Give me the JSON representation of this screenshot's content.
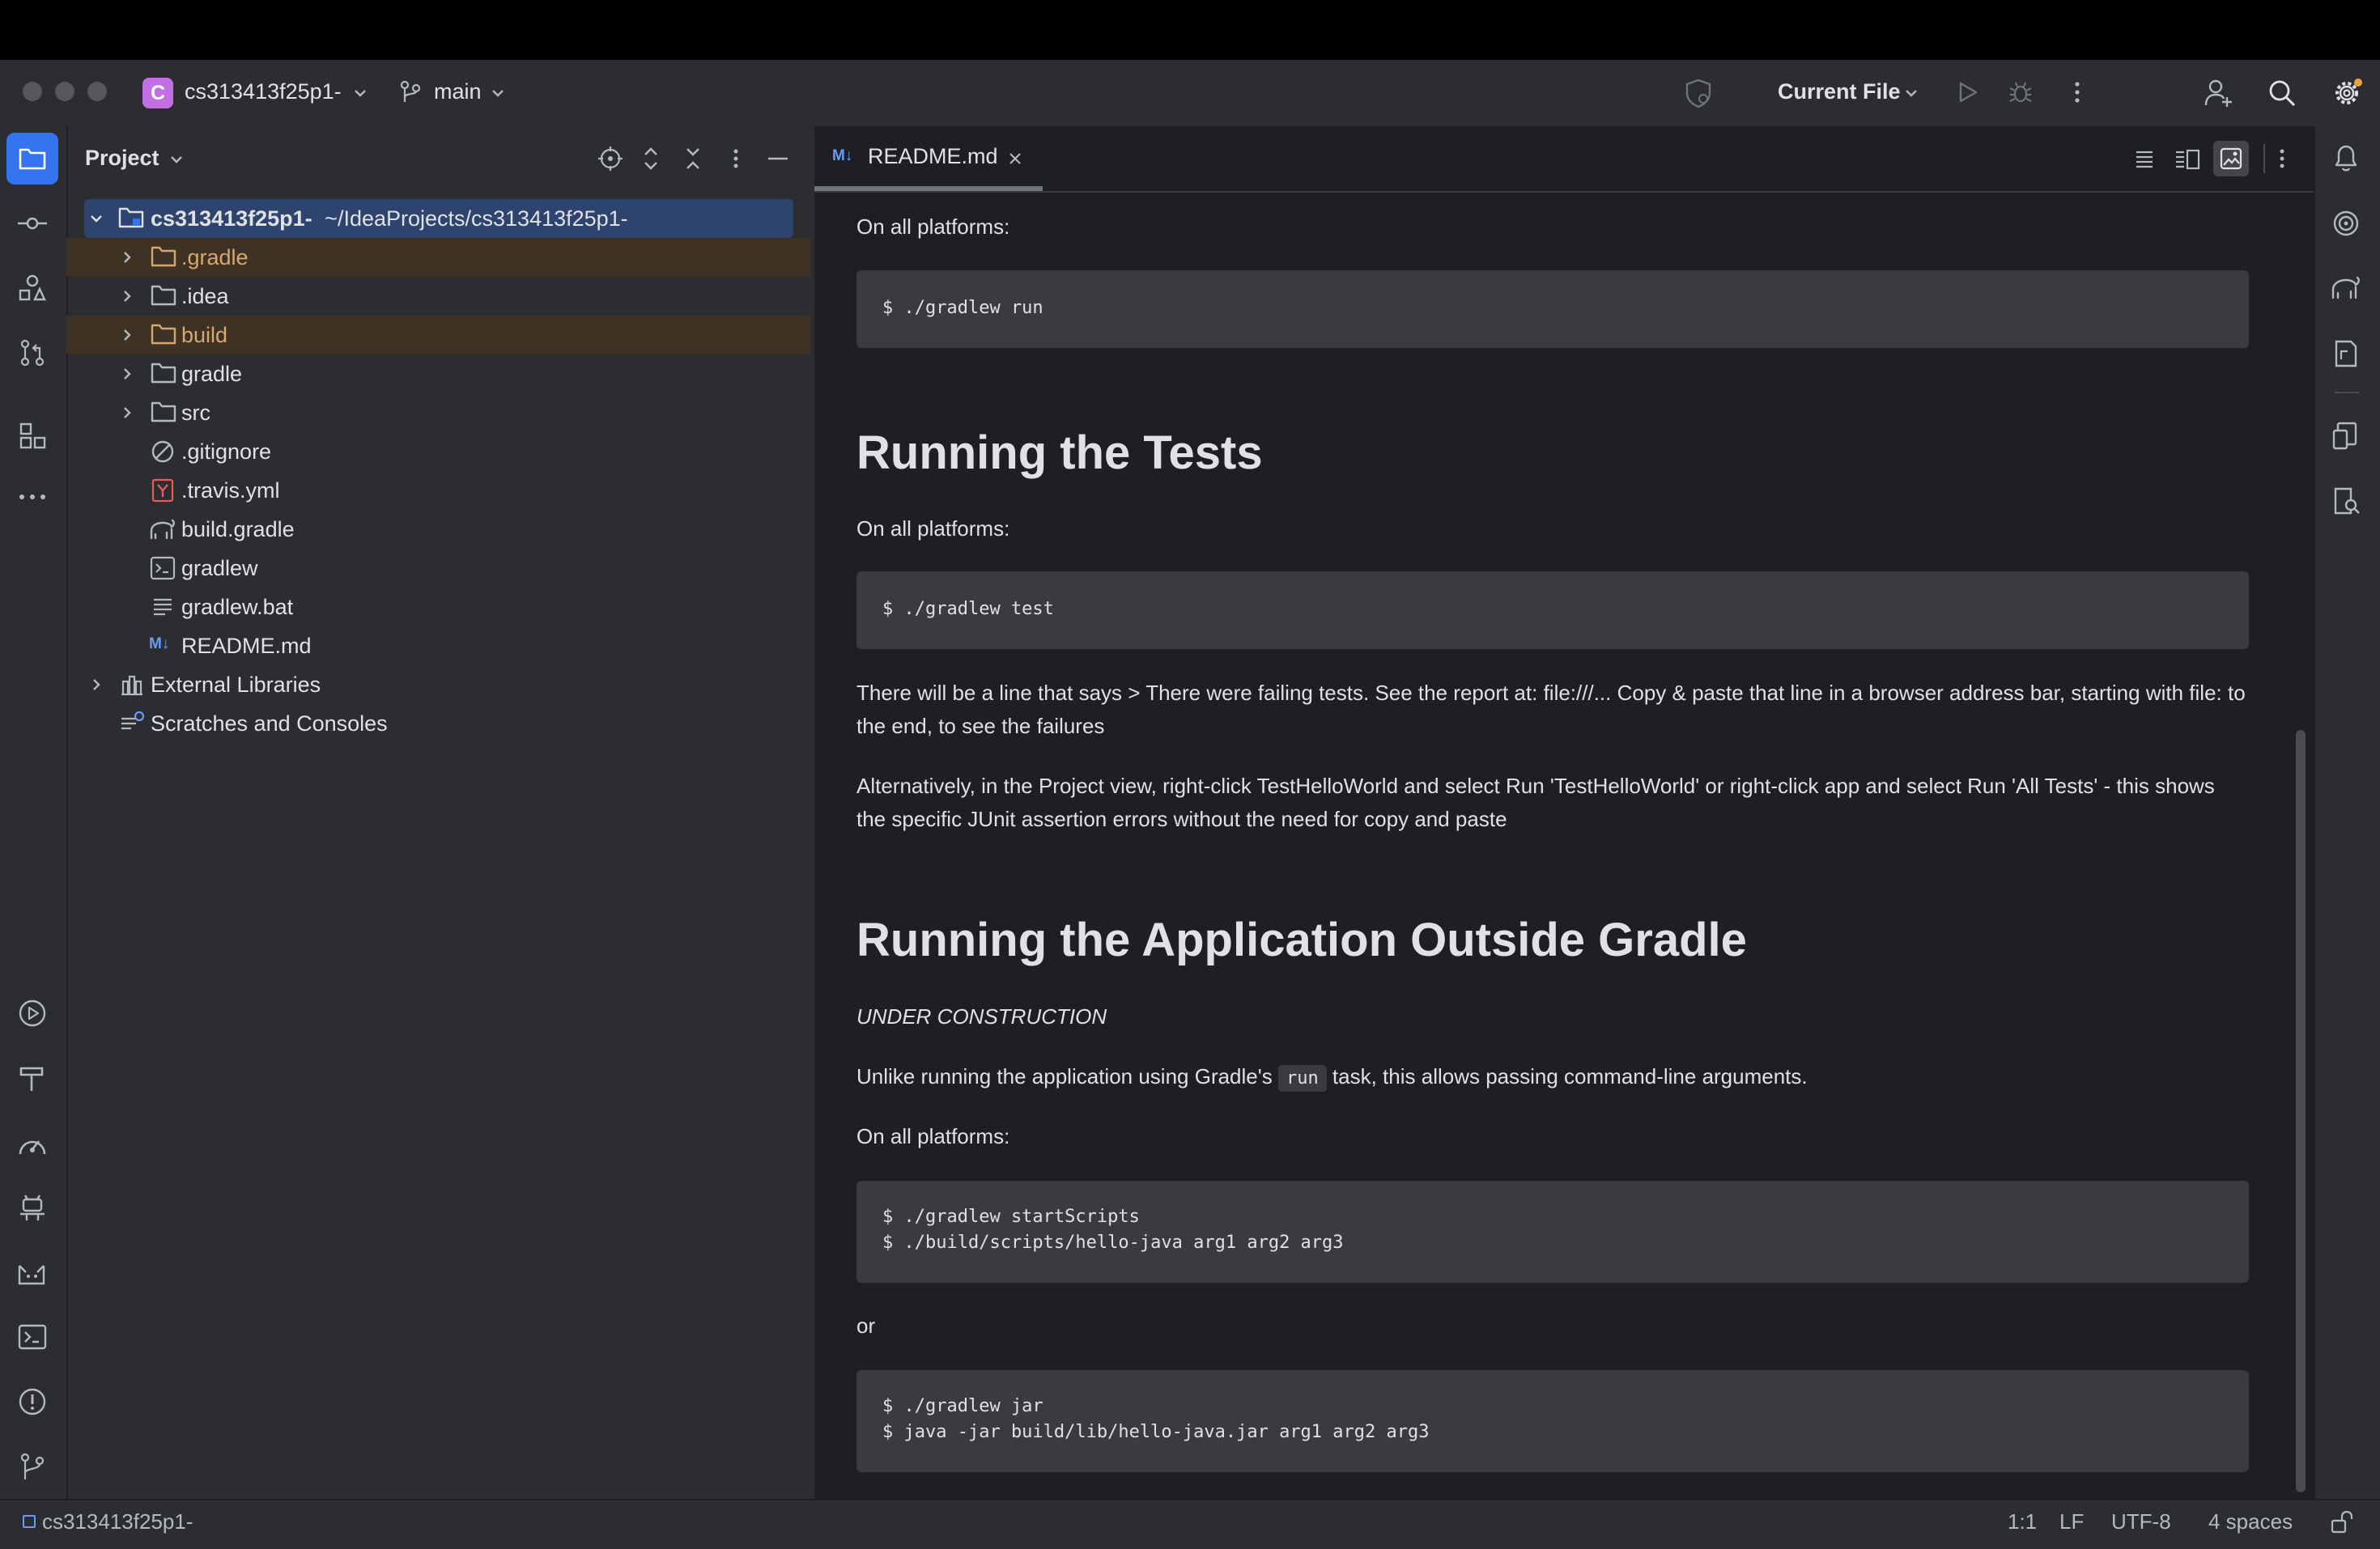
{
  "titlebar": {
    "project_badge": "C",
    "project_name": "cs313413f25p1-",
    "branch": "main",
    "run_config": "Current File"
  },
  "project_panel": {
    "title": "Project",
    "root_name": "cs313413f25p1-",
    "root_path": "~/IdeaProjects/cs313413f25p1-",
    "items": [
      {
        "label": ".gradle"
      },
      {
        "label": ".idea"
      },
      {
        "label": "build"
      },
      {
        "label": "gradle"
      },
      {
        "label": "src"
      },
      {
        "label": ".gitignore"
      },
      {
        "label": ".travis.yml"
      },
      {
        "label": "build.gradle"
      },
      {
        "label": "gradlew"
      },
      {
        "label": "gradlew.bat"
      },
      {
        "label": "README.md"
      }
    ],
    "external_libraries": "External Libraries",
    "scratches": "Scratches and Consoles"
  },
  "editor": {
    "tab_badge": "M↓",
    "tab_label": "README.md"
  },
  "content": {
    "p1": "On all platforms:",
    "code1": "$ ./gradlew run",
    "h1": "Running the Tests",
    "p2": "On all platforms:",
    "code2": "$ ./gradlew test",
    "p3": "There will be a line that says > There were failing tests. See the report at: file:///... Copy & paste that line in a browser address bar, starting with file: to the end, to see the failures",
    "p4": "Alternatively, in the Project view, right-click TestHelloWorld and select Run 'TestHelloWorld' or right-click app and select Run 'All Tests' - this shows the specific JUnit assertion errors without the need for copy and paste",
    "h2": "Running the Application Outside Gradle",
    "p5": "UNDER CONSTRUCTION",
    "p6_before": "Unlike running the application using Gradle's ",
    "p6_code": "run",
    "p6_after": " task, this allows passing command-line arguments.",
    "p7": "On all platforms:",
    "code3_line1": "$ ./gradlew startScripts",
    "code3_line2": "$ ./build/scripts/hello-java arg1 arg2 arg3",
    "p8": "or",
    "code4_line1": "$ ./gradlew jar",
    "code4_line2": "$ java -jar build/lib/hello-java.jar arg1 arg2 arg3"
  },
  "statusbar": {
    "project": "cs313413f25p1-",
    "position": "1:1",
    "line_sep": "LF",
    "encoding": "UTF-8",
    "indent": "4 spaces"
  },
  "colors": {
    "accent": "#3574f0",
    "selection": "#2e436e",
    "excluded_bg": "#3d3223",
    "excluded_text": "#d5a86e",
    "project_badge": "#c36fe4"
  }
}
